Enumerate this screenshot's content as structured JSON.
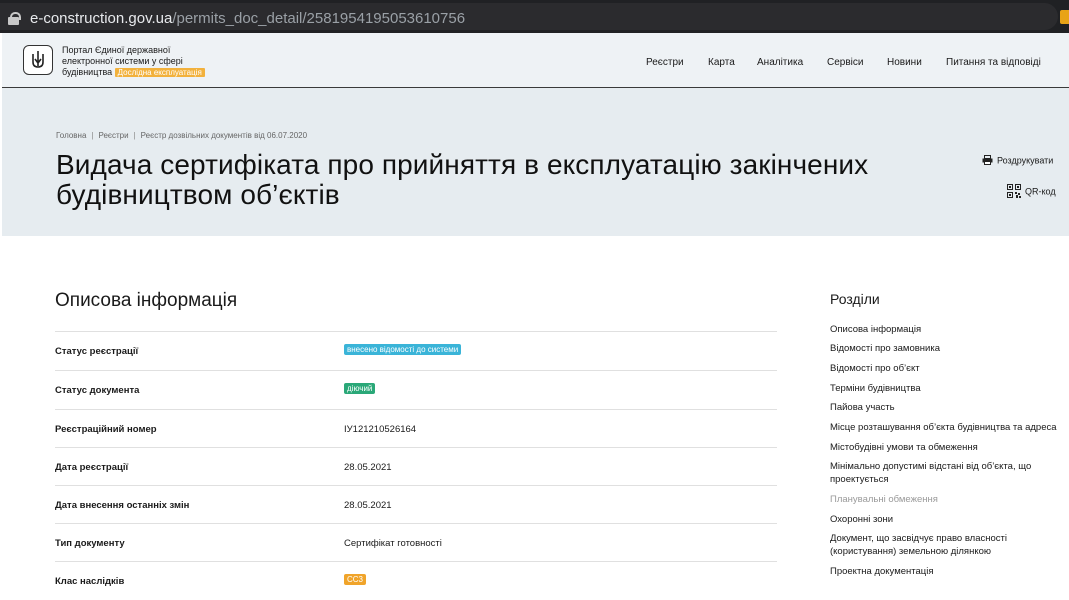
{
  "browser": {
    "host": "e-construction.gov.ua",
    "path": "/permits_doc_detail/2581954195053610756"
  },
  "header": {
    "brand_line1": "Портал Єдиної державної",
    "brand_line2": "електронної системи у сфері",
    "brand_line3": "будівництва",
    "beta_badge": "Дослідна експлуатація",
    "nav": [
      "Реєстри",
      "Карта",
      "Аналітика",
      "Сервіси",
      "Новини",
      "Питання та відповіді"
    ]
  },
  "breadcrumbs": [
    "Головна",
    "Реєстри",
    "Реєстр дозвільних документів від 06.07.2020"
  ],
  "page_title": "Видача сертифіката про прийняття в експлуатацію закінчених будівництвом об’єктів",
  "actions": {
    "print": "Роздрукувати",
    "qr": "QR-код"
  },
  "section_title": "Описова інформація",
  "rows": [
    {
      "label": "Статус реєстрації",
      "value": "внесено відомості до системи",
      "badge": true,
      "color": "#3ab4d8"
    },
    {
      "label": "Статус документа",
      "value": "діючий",
      "badge": true,
      "color": "#2aa878"
    },
    {
      "label": "Реєстраційний номер",
      "value": "ІУ121210526164",
      "badge": false
    },
    {
      "label": "Дата реєстрації",
      "value": "28.05.2021",
      "badge": false
    },
    {
      "label": "Дата внесення останніх змін",
      "value": "28.05.2021",
      "badge": false
    },
    {
      "label": "Тип документу",
      "value": "Сертифікат готовності",
      "badge": false
    },
    {
      "label": "Клас наслідків",
      "value": "СС3",
      "badge": true,
      "color": "#f0a42a"
    }
  ],
  "sidebar": {
    "title": "Розділи",
    "items": [
      "Описова інформація",
      "Відомості про замовника",
      "Відомості про об’єкт",
      "Терміни будівництва",
      "Пайова участь",
      "Місце розташування об’єкта будівництва та адреса",
      "Містобудівні умови та обмеження",
      "Мінімально допустимі відстані від об’єкта, що проектується",
      "Планувальні обмеження",
      "Охоронні зони",
      "Документ, що засвідчує право власності (користування) земельною ділянкою",
      "Проектна документація"
    ]
  }
}
